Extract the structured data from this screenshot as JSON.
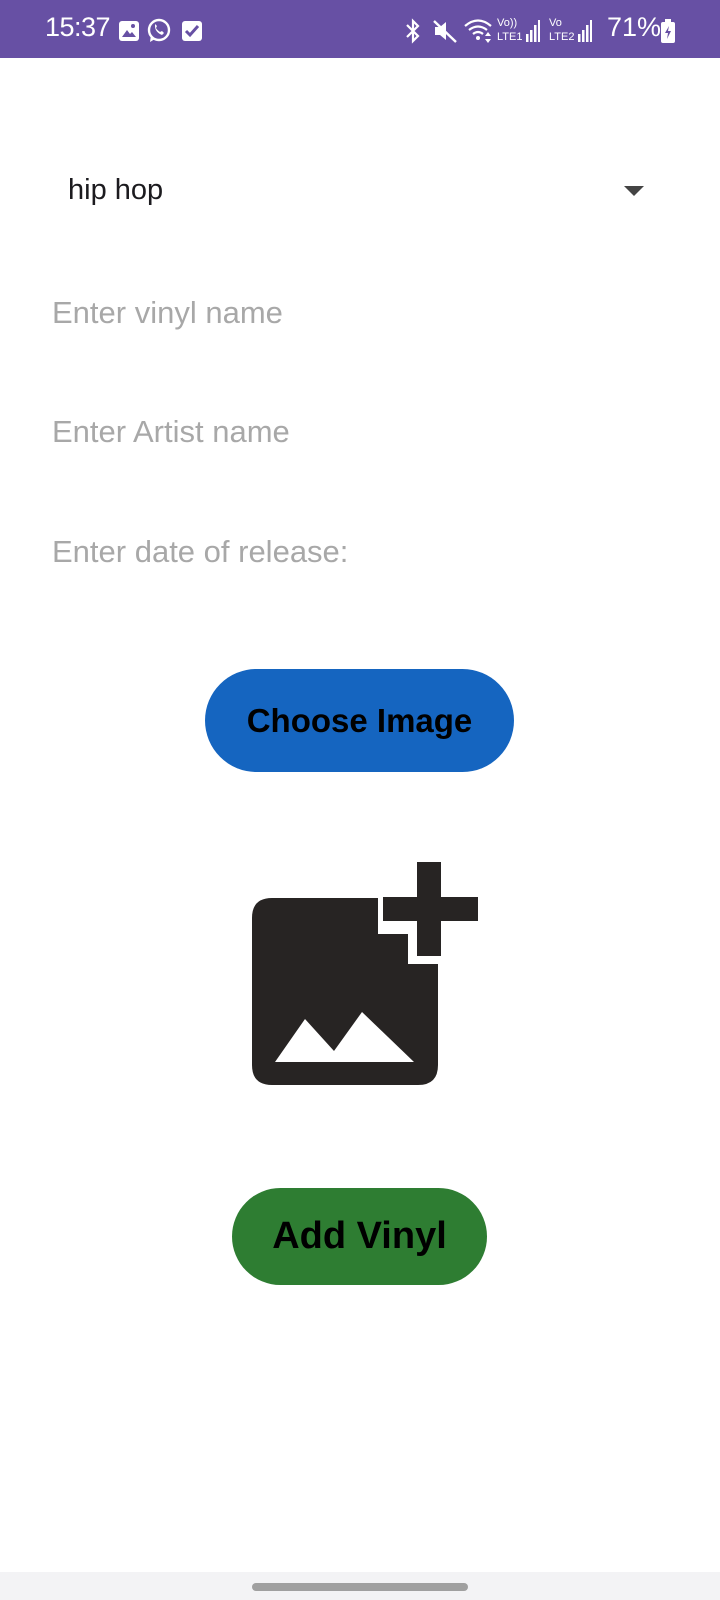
{
  "status_bar": {
    "time": "15:37",
    "battery": "71%",
    "background_color": "#6750a4",
    "icons_left": [
      "gallery-icon",
      "whatsapp-icon",
      "checkbox-icon"
    ],
    "icons_right": [
      "bluetooth-icon",
      "mute-icon",
      "wifi-icon",
      "signal-sim1-icon",
      "signal-sim2-icon",
      "battery-icon"
    ],
    "lte1_label": "LTE1",
    "lte2_label": "LTE2",
    "volte1_label": "Vo))",
    "volte2_label": "Vo"
  },
  "genre_spinner": {
    "selected": "hip hop"
  },
  "form": {
    "vinyl_name_placeholder": "Enter vinyl name",
    "artist_name_placeholder": "Enter Artist name",
    "release_date_placeholder": "Enter date of release:"
  },
  "buttons": {
    "choose_image": "Choose Image",
    "add_vinyl": "Add Vinyl",
    "choose_image_color": "#1565c0",
    "add_vinyl_color": "#2e7d32"
  },
  "preview": {
    "icon": "add-photo-icon"
  }
}
